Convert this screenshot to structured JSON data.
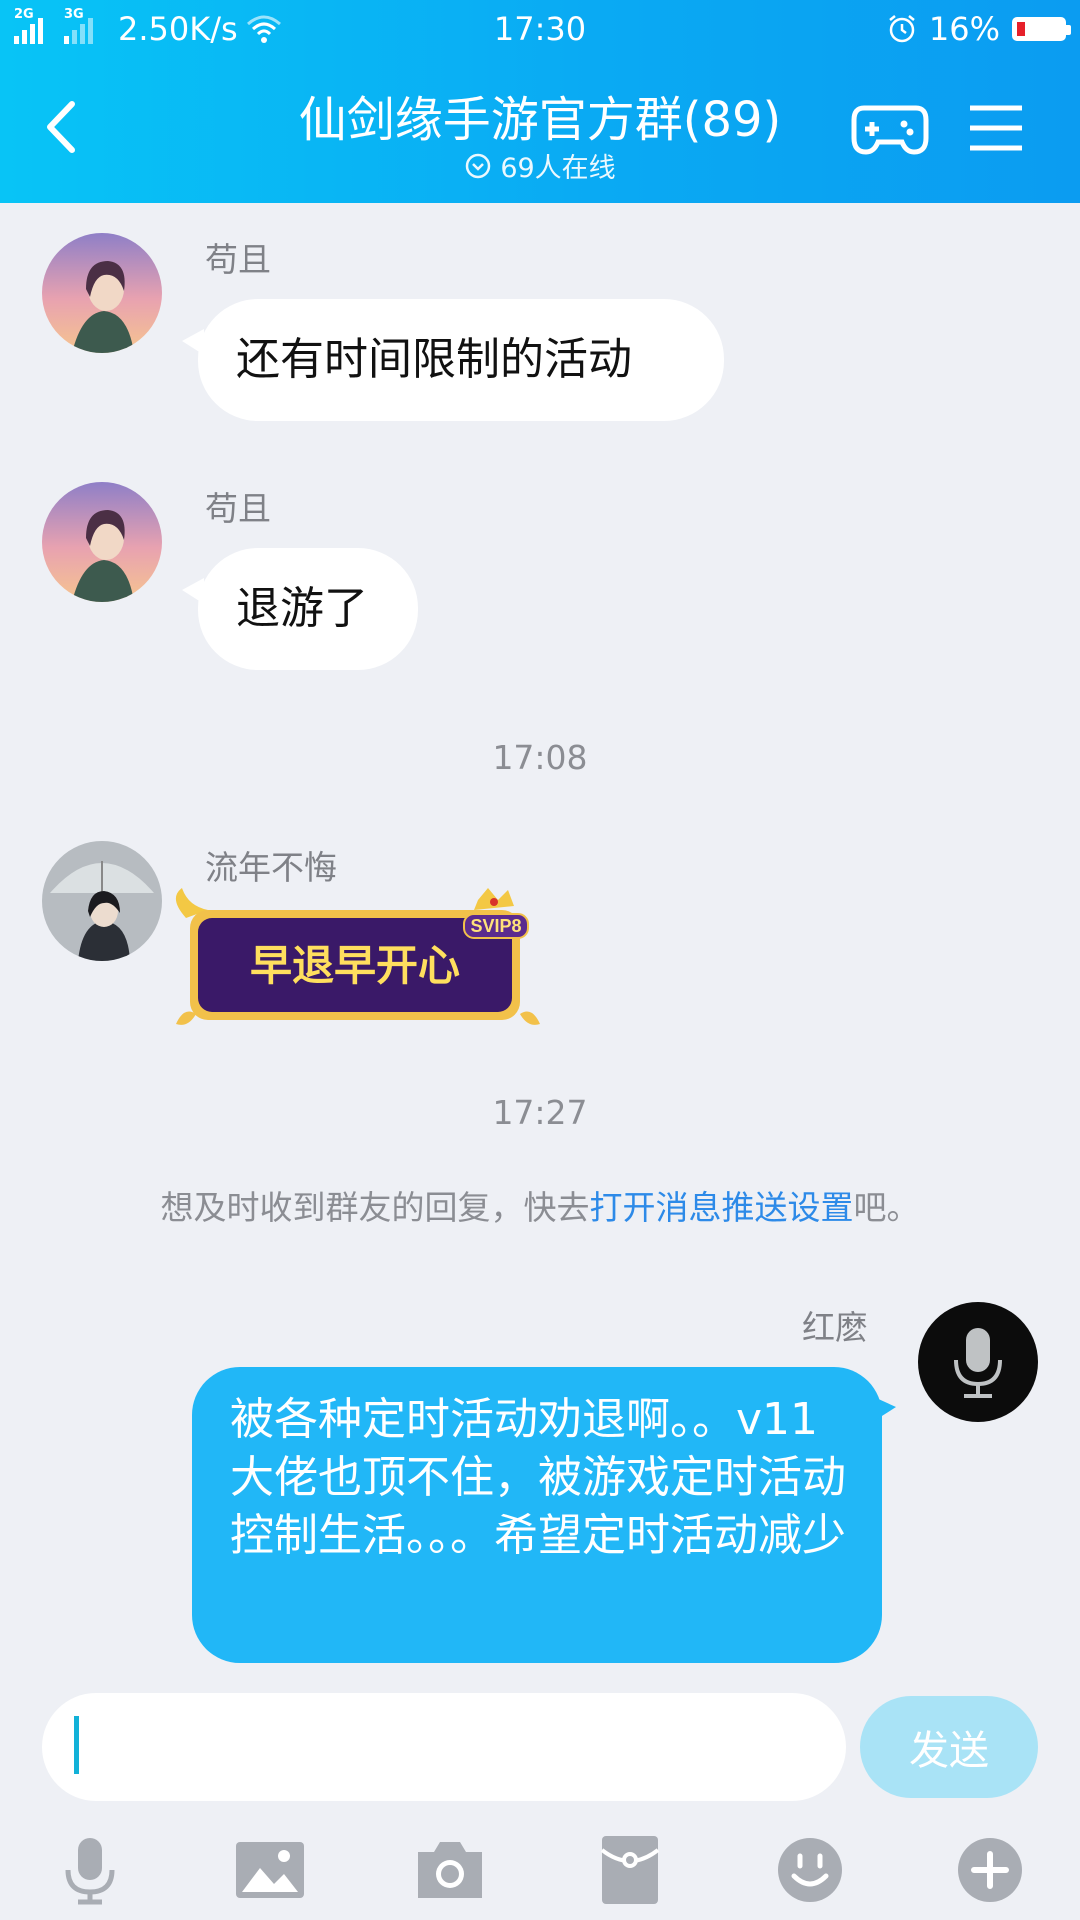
{
  "status_bar": {
    "signal1_tag": "2G",
    "signal2_tag": "3G",
    "net_speed": "2.50K/s",
    "time": "17:30",
    "battery": "16%",
    "battery_level": 0.16,
    "icons": [
      "signal-icon",
      "wifi-icon",
      "alarm-icon",
      "battery-icon"
    ]
  },
  "header": {
    "title": "仙剑缘手游官方群(89)",
    "online": "69人在线",
    "icons": [
      "back-arrow-icon",
      "gamepad-icon",
      "menu-icon",
      "chevron-circle-icon"
    ]
  },
  "messages": [
    {
      "sender": "苟且",
      "text": "还有时间限制的活动"
    },
    {
      "sender": "苟且",
      "text": "退游了"
    },
    {
      "timestamp": "17:08"
    },
    {
      "sender": "流年不悔",
      "sticker_text": "早退早开心",
      "sticker_badge": "SVIP8"
    },
    {
      "timestamp": "17:27"
    },
    {
      "notice_pre": "想及时收到群友的回复，快去",
      "notice_link": "打开消息推送设置",
      "notice_post": "吧。"
    },
    {
      "sender": "红麽",
      "self": true,
      "text": "被各种定时活动劝退啊。。v11大佬也顶不住，被游戏定时活动控制生活。。。希望定时活动减少"
    }
  ],
  "input": {
    "value": "",
    "send_label": "发送"
  },
  "toolbar": [
    "microphone-icon",
    "image-icon",
    "camera-icon",
    "red-packet-icon",
    "emoji-icon",
    "plus-icon"
  ],
  "colors": {
    "header": "#0aaaf3",
    "bubble_self": "#21b7f7",
    "link": "#2d8ae8",
    "send": "#a9e3f6"
  }
}
